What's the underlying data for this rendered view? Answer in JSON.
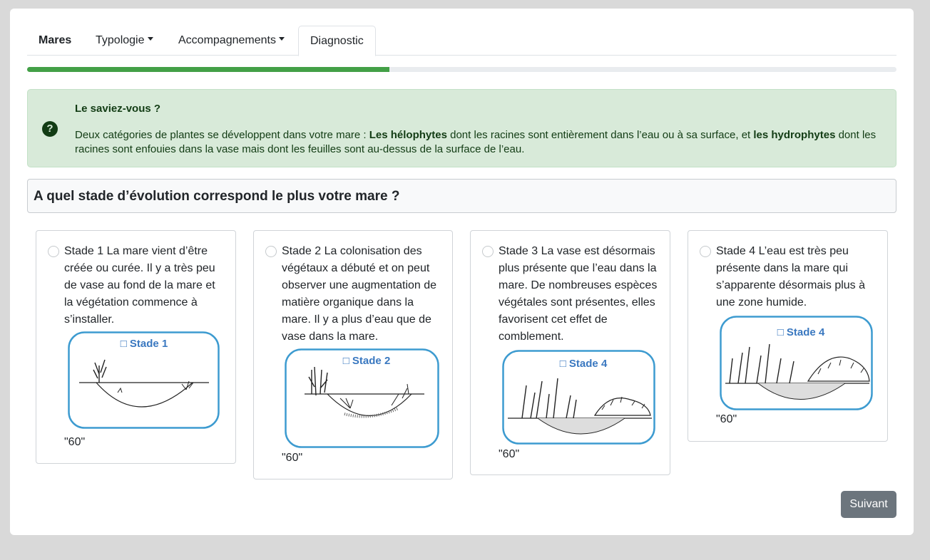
{
  "nav": {
    "items": [
      {
        "label": "Mares"
      },
      {
        "label": "Typologie"
      },
      {
        "label": "Accompagnements"
      },
      {
        "label": "Diagnostic"
      }
    ]
  },
  "progress": {
    "fraction": 0.417
  },
  "info": {
    "icon": "question-circle-icon",
    "title": "Le saviez-vous ?",
    "text_1": "Deux catégories de plantes se développent dans votre mare : ",
    "bold_1": "Les hélophytes",
    "text_2": " dont les racines sont entièrement dans l’eau ou à sa surface, et ",
    "bold_2": "les hydrophytes",
    "text_3": " dont les racines sont enfouies dans la vase mais dont les feuilles sont au-dessus de la surface de l’eau."
  },
  "question": {
    "title": "A quel stade d’évolution correspond le plus votre mare ?"
  },
  "options": [
    {
      "lines": [
        "Stade 1 La mare vient d’être",
        "créée ou curée. Il y a très peu",
        "de vase au fond de la mare et",
        "la végétation commence à",
        "s’installer."
      ],
      "image_label": "□ Stade 1",
      "value": "\"60\""
    },
    {
      "lines": [
        "Stade 2 La colonisation des",
        "végétaux a débuté et on peut",
        "observer une augmentation de",
        "matière organique dans la",
        "mare. Il y a plus d’eau que de",
        "vase dans la mare."
      ],
      "image_label": "□ Stade 2",
      "value": "\"60\""
    },
    {
      "lines": [
        "Stade 3 La vase est désormais",
        "plus présente que l’eau dans la",
        "mare. De nombreuses espèces",
        "végétales sont présentes, elles",
        "favorisent cet effet de",
        "comblement."
      ],
      "image_label": "□ Stade 4",
      "value": "\"60\""
    },
    {
      "lines": [
        "Stade 4 L’eau est très peu",
        "présente dans la mare qui",
        "s’apparente désormais plus à",
        "une zone humide."
      ],
      "image_label": "□ Stade 4",
      "value": "\"60\""
    }
  ],
  "buttons": {
    "next": "Suivant"
  },
  "colors": {
    "accent_green": "#43a047",
    "image_border": "#3d9bd0",
    "image_label": "#3a78c0"
  }
}
